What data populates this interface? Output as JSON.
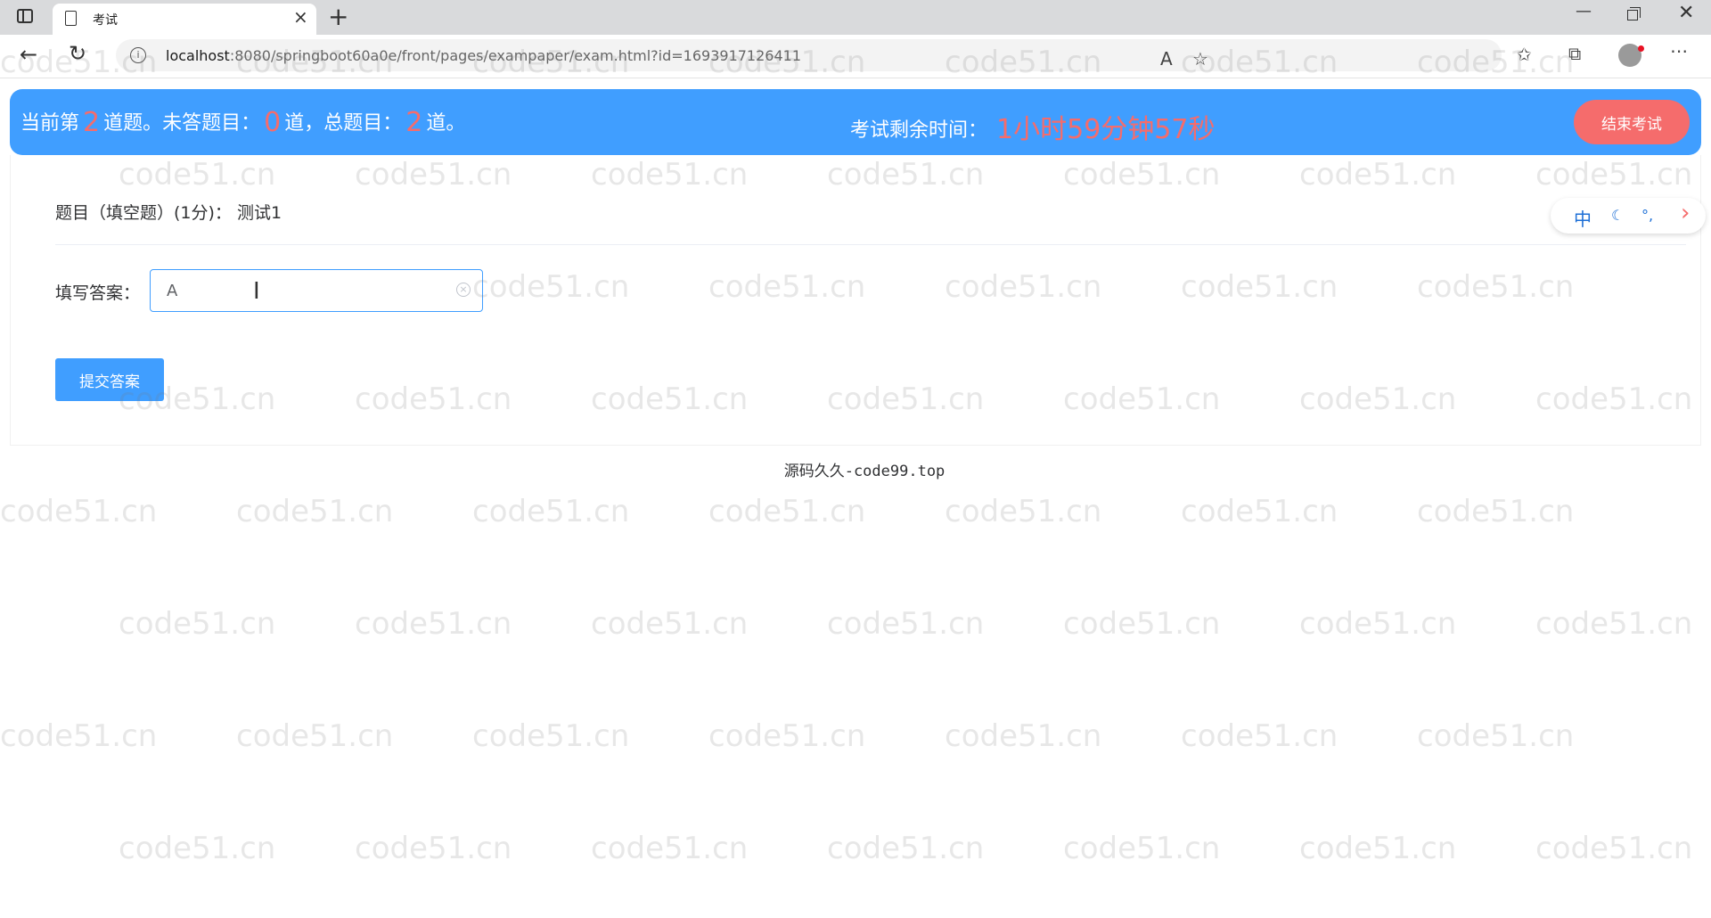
{
  "browser": {
    "tab_title": "考试",
    "tab_close": "×",
    "new_tab": "+",
    "url_host": "localhost",
    "url_path": ":8080/springboot60a0e/front/pages/exampaper/exam.html?id=1693917126411",
    "window_controls": {
      "minimize": "—",
      "close": "✕"
    }
  },
  "exam_header": {
    "current_prefix": "当前第",
    "current_number": "2",
    "current_suffix": "道题。未答题目：",
    "unanswered_number": "0",
    "unanswered_suffix": "道，总题目：",
    "total_number": "2",
    "total_suffix": "道。",
    "timer_label": "考试剩余时间：",
    "timer_value": "1小时59分钟57秒",
    "end_button": "结束考试"
  },
  "question": {
    "title": "题目（填空题）(1分)：  测试1",
    "answer_label": "填写答案：",
    "answer_value": "A",
    "submit_button": "提交答案"
  },
  "ime_toolbar": {
    "lang": "中",
    "moon": "☾",
    "punct": "°,",
    "arrow": "›"
  },
  "footer": "源码久久-code99.top",
  "watermark_text": "code51.cn",
  "colors": {
    "header_bg": "#409eff",
    "accent_red": "#f56c6c",
    "submit_bg": "#409eff"
  }
}
